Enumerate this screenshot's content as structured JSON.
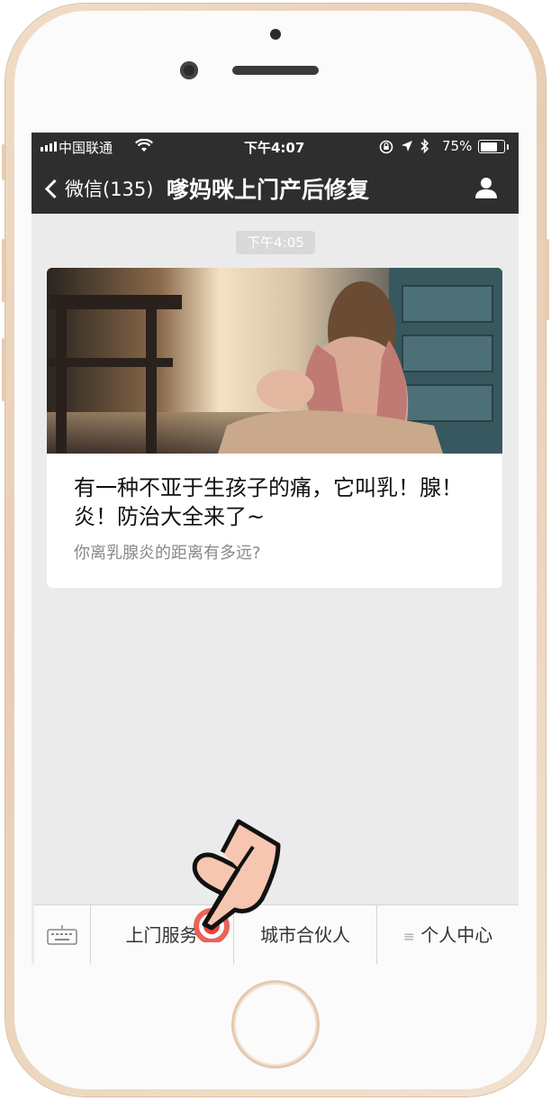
{
  "status_bar": {
    "carrier": "中国联通",
    "time": "下午4:07",
    "battery": "75%",
    "battery_level": 0.75
  },
  "nav": {
    "back_label": "微信(135)",
    "title": "嗲妈咪上门产后修复",
    "right_icon": "user-icon"
  },
  "chat": {
    "timestamp": "下午4:05"
  },
  "article": {
    "title": "有一种不亚于生孩子的痛，它叫乳！腺！炎！防治大全来了~",
    "description": "你离乳腺炎的距离有多远?"
  },
  "menu": {
    "items": [
      {
        "label": "上门服务"
      },
      {
        "label": "城市合伙人"
      },
      {
        "label": "个人中心"
      }
    ],
    "third_prefix": "≡"
  },
  "colors": {
    "nav_bg": "#2e2e2e",
    "chat_bg": "#ebebeb",
    "tap_indicator": "#e8463c",
    "phone_frame": "#ecd4bb"
  }
}
